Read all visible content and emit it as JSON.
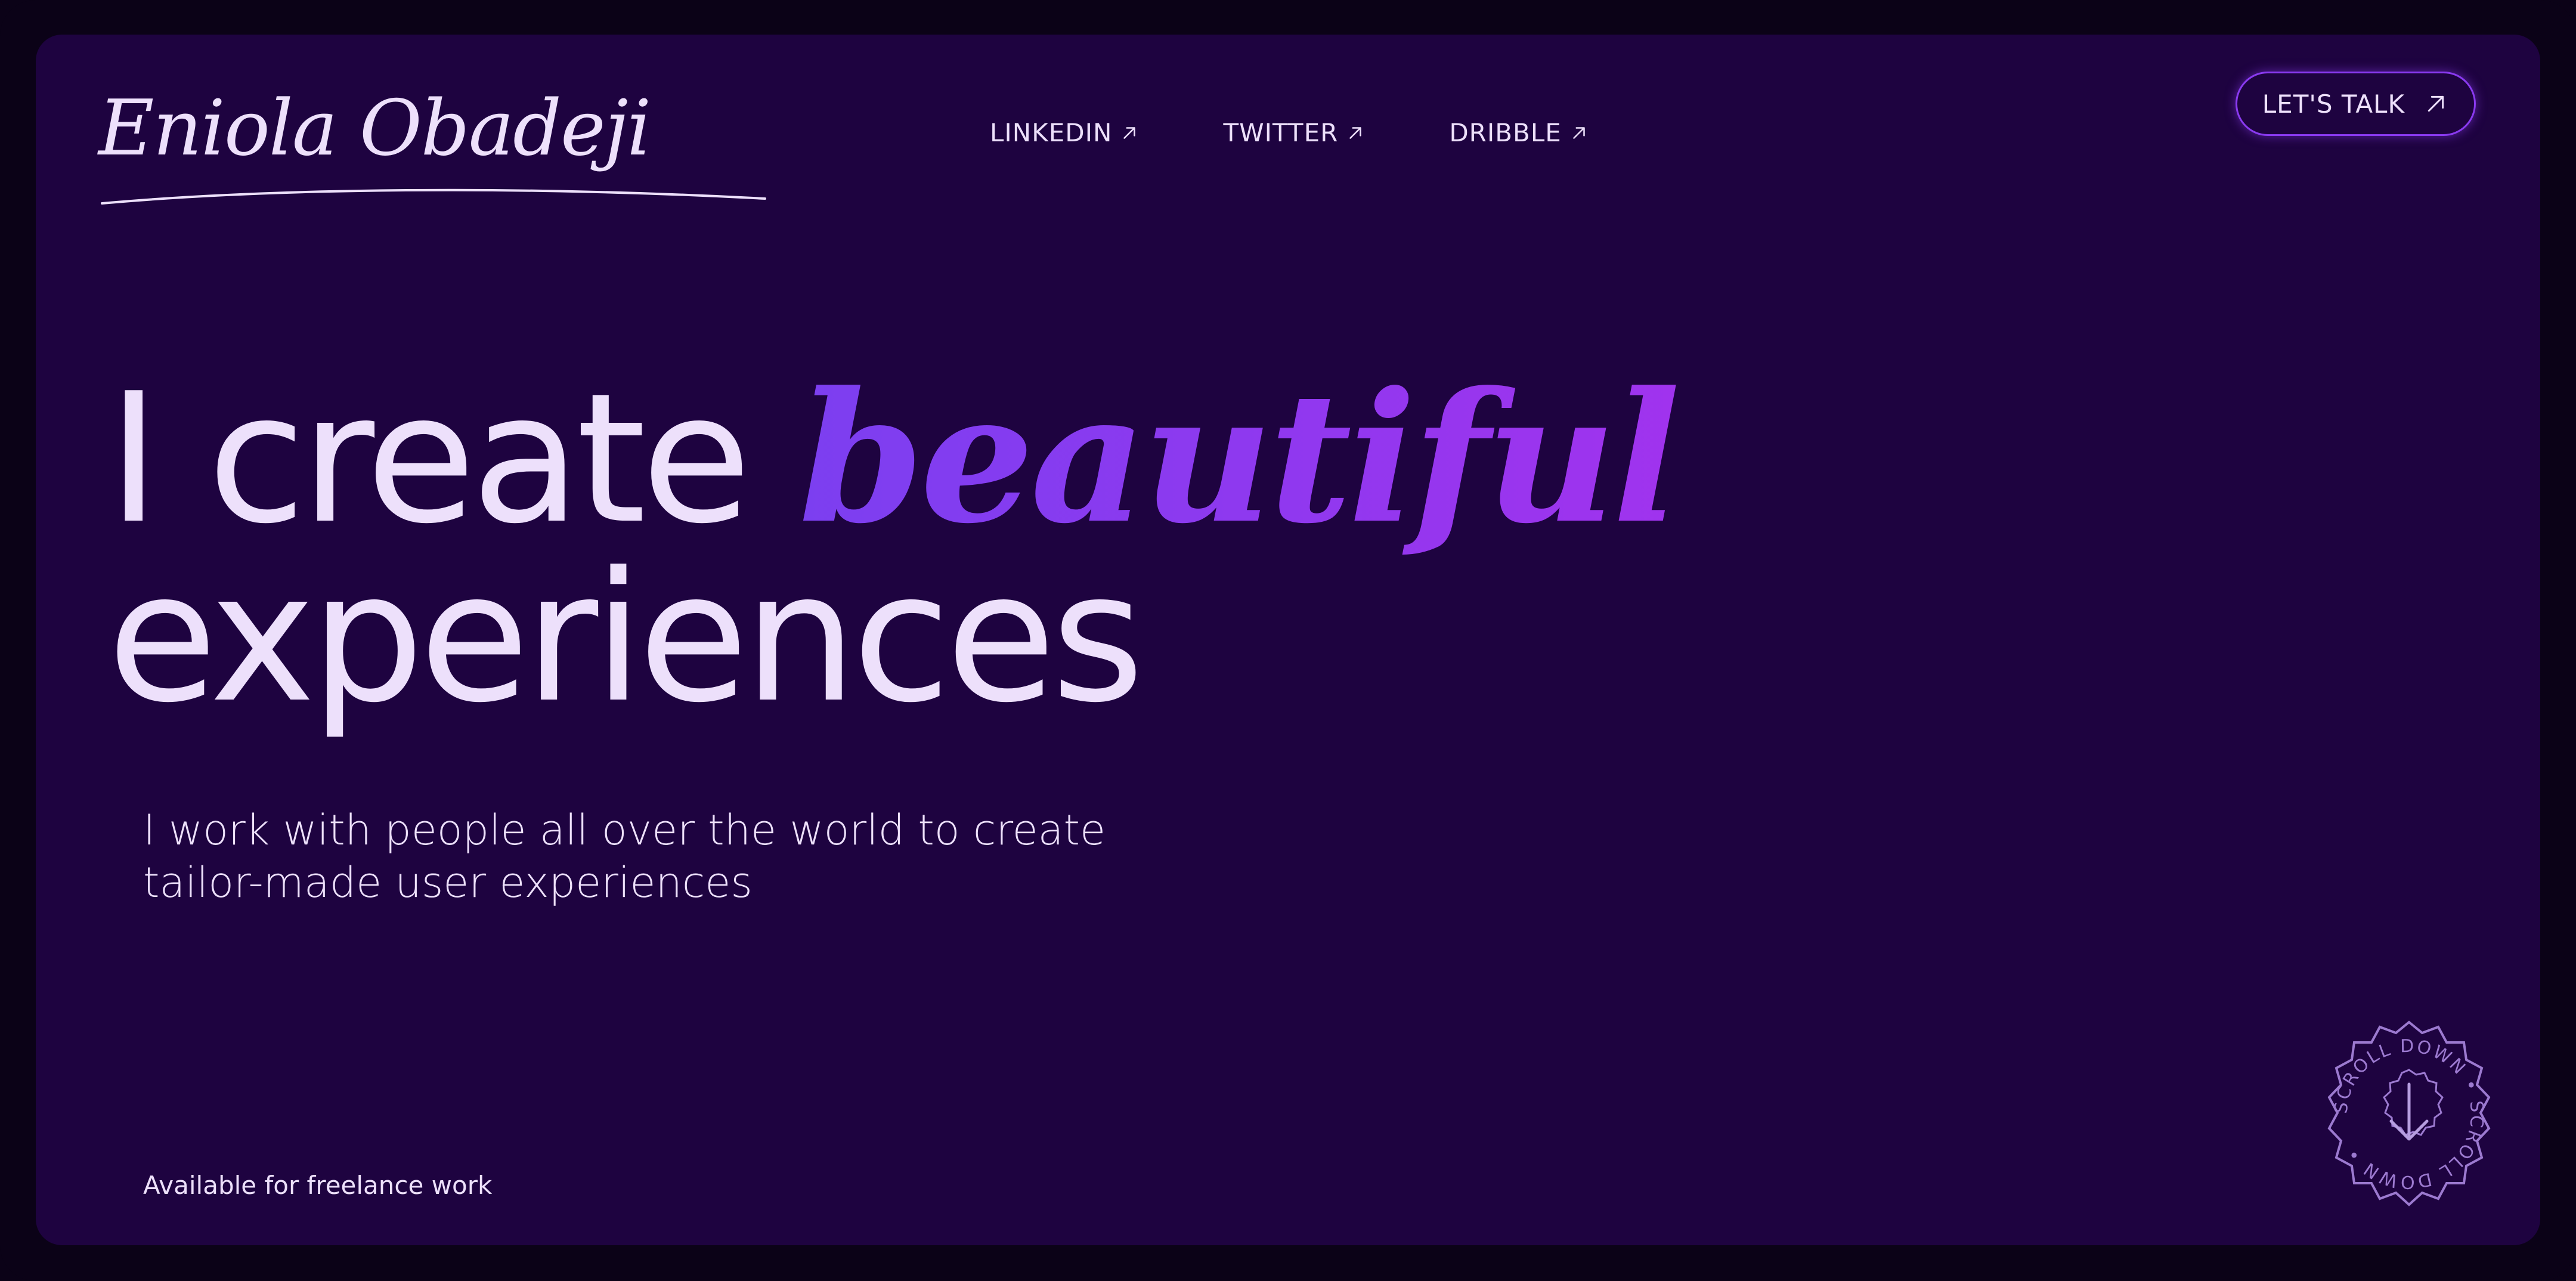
{
  "brand": {
    "name": "Eniola Obadeji"
  },
  "nav": {
    "links": [
      {
        "label": "LINKEDIN"
      },
      {
        "label": "TWITTER"
      },
      {
        "label": "DRIBBLE"
      }
    ],
    "cta_label": "LET'S TALK"
  },
  "hero": {
    "line1_prefix": "I create ",
    "line1_accent": "beautiful",
    "line2": "experiences",
    "subtitle_line1": "I work with people all over the world to create",
    "subtitle_line2": "tailor-made user experiences"
  },
  "footer": {
    "availability": "Available for freelance work"
  },
  "scroll_badge": {
    "text": "SCROLL DOWN • SCROLL DOWN •"
  },
  "colors": {
    "background": "#0b0217",
    "panel": "#1e0340",
    "text": "#ede0fb",
    "accent_start": "#7c3ff0",
    "accent_end": "#a033ee",
    "cta_border": "#8a3af0",
    "badge": "#9c7ad0"
  },
  "icons": {
    "external_link": "arrow-up-right-icon",
    "scroll": "arrow-down-icon"
  }
}
